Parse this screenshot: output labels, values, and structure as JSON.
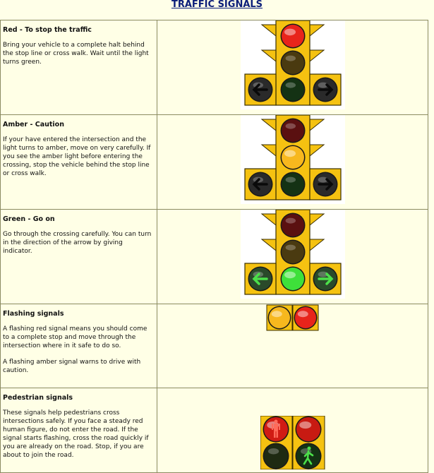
{
  "page": {
    "title": "TRAFFIC SIGNALS"
  },
  "rows": [
    {
      "title": "Red - To stop the traffic",
      "paragraphs": [
        "Bring your vehicle to a complete halt behind the stop line or cross walk. Wait until the light turns green."
      ],
      "icon": "traffic-light-red-icon"
    },
    {
      "title": "Amber - Caution",
      "paragraphs": [
        "If your have entered the intersection and the light turns to amber, move on very carefully. If you see the amber light before entering the crossing, stop the vehicle behind the stop line or cross walk."
      ],
      "icon": "traffic-light-amber-icon"
    },
    {
      "title": "Green - Go on",
      "paragraphs": [
        "Go through the crossing carefully. You can turn in the direction of the arrow by giving indicator."
      ],
      "icon": "traffic-light-green-icon"
    },
    {
      "title": "Flashing signals",
      "paragraphs": [
        "A flashing red signal means you should come to a complete stop and move through the intersection where in it safe to do so.",
        "A flashing amber signal warns to drive with caution."
      ],
      "icon": "flashing-signal-icon"
    },
    {
      "title": "Pedestrian signals",
      "paragraphs": [
        "These signals help pedestrians cross intersections safely. If you face a steady red human figure, do not enter the road. If the signal starts flashing, cross the road quickly if you are already on the road. Stop, if you are about to join the road."
      ],
      "icon": "pedestrian-signal-icon"
    }
  ],
  "colors": {
    "title": "#0c1e7a",
    "background": "#ffffe6",
    "border": "#8b8b62",
    "housing": "#f5c211",
    "red_on": "#e8241b",
    "amber_on": "#f7b81e",
    "green_on": "#3ee03a",
    "arrow_green": "#4ce04a"
  }
}
